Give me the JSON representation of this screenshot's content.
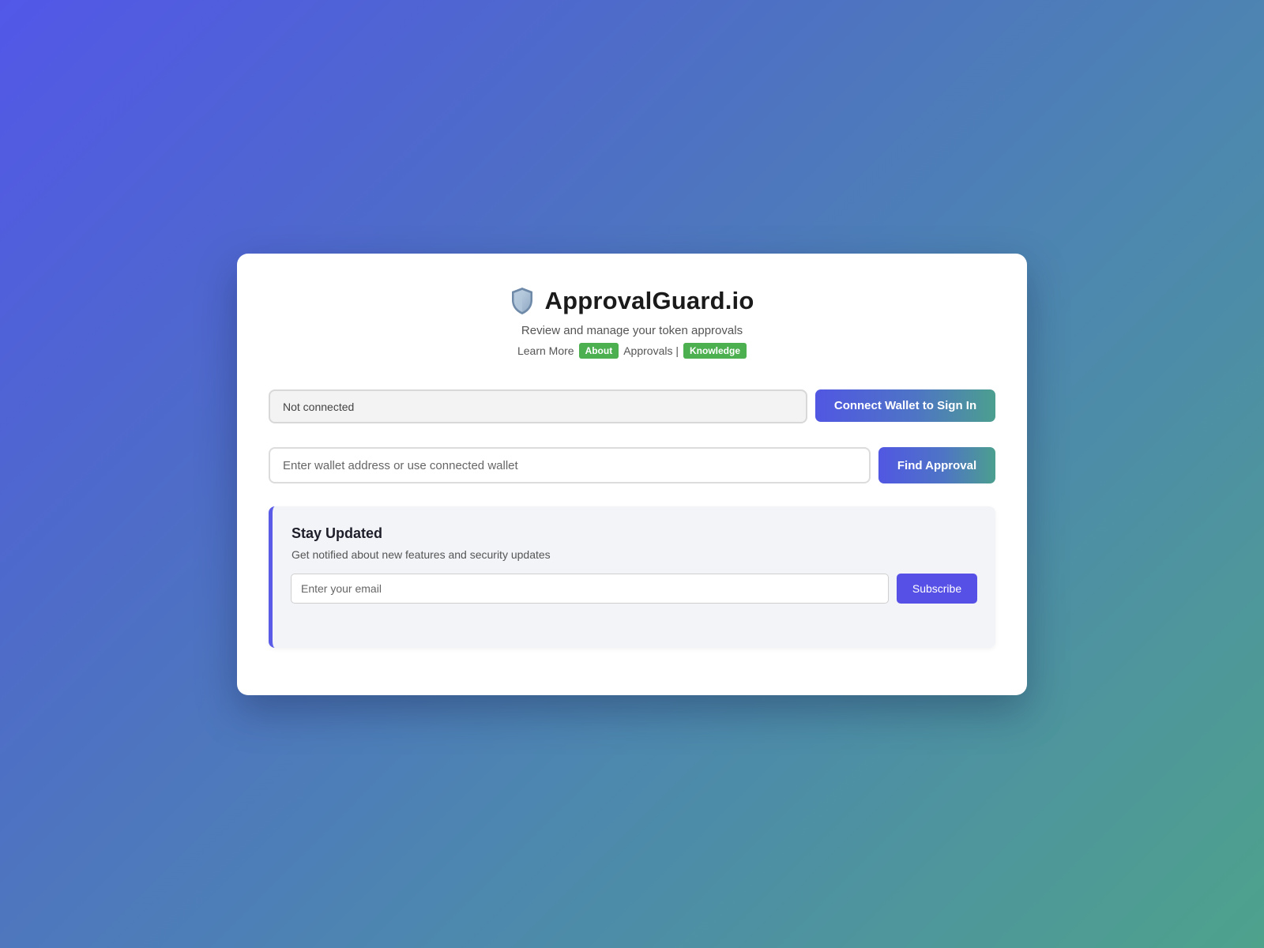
{
  "header": {
    "icon": "shield-icon",
    "title": "ApprovalGuard.io",
    "subtitle": "Review and manage your token approvals",
    "links": {
      "learn_more": "Learn More",
      "about_badge": "About",
      "approvals_text": "Approvals |",
      "knowledge_badge": "Knowledge"
    }
  },
  "wallet": {
    "status": "Not connected",
    "connect_label": "Connect Wallet to Sign In"
  },
  "search": {
    "placeholder": "Enter wallet address or use connected wallet",
    "button_label": "Find Approval"
  },
  "newsletter": {
    "title": "Stay Updated",
    "description": "Get notified about new features and security updates",
    "email_placeholder": "Enter your email",
    "subscribe_label": "Subscribe"
  },
  "colors": {
    "accent": "#5a5ce8",
    "badge_green": "#4caf50",
    "gradient_start": "#5157e2",
    "gradient_end": "#4c9f8f"
  }
}
